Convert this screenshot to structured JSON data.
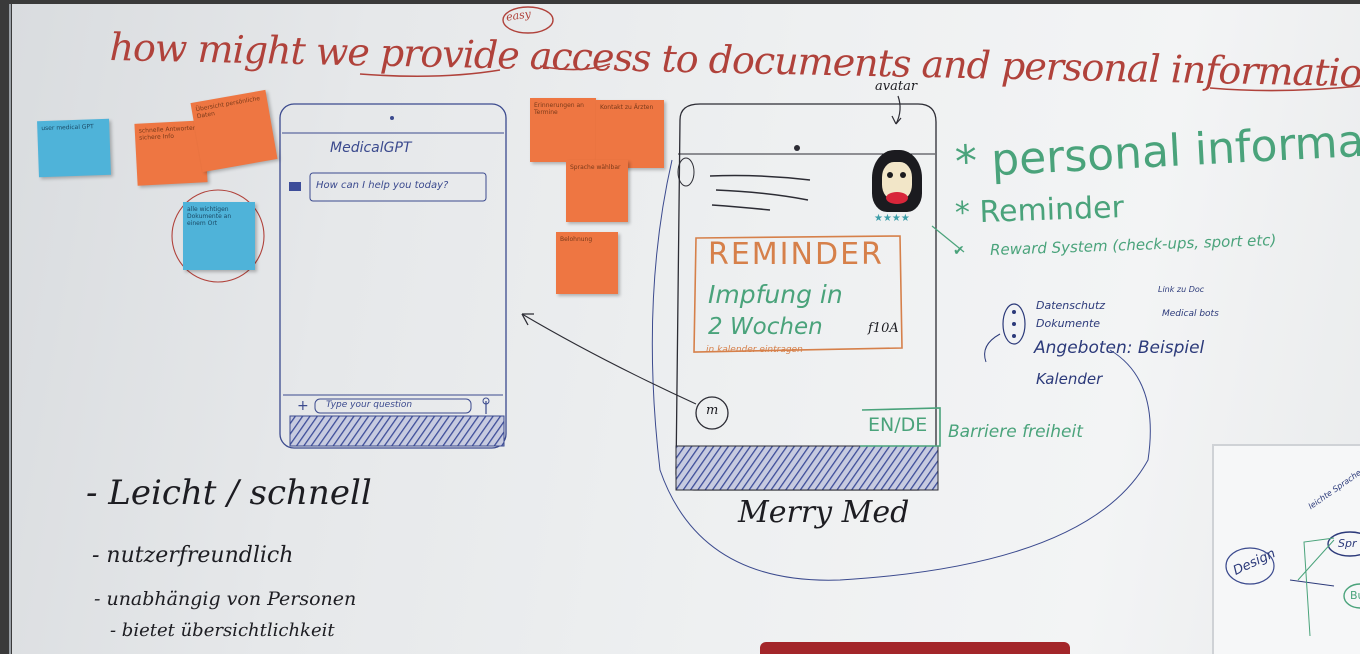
{
  "title": "how might we provide access to documents and personal information TO Students",
  "title_insert": "easy",
  "phone1": {
    "app_name": "MedicalGPT",
    "prompt": "How can I help you today?",
    "input_placeholder": "Type your question"
  },
  "phone2": {
    "avatar_label": "avatar",
    "reminder_heading": "REMINDER",
    "reminder_line1": "Impfung in",
    "reminder_line2": "2 Wochen",
    "reminder_extra": "f10A",
    "calendar_note": "in kalender eintragen",
    "lang_toggle": "EN/DE",
    "name_below": "Merry Med",
    "circle_label": "m"
  },
  "right_list": {
    "item1": "* personal informat",
    "item2": "* Reminder",
    "item3": "Reward System (check-ups, sport etc)",
    "sub1": "Datenschutz",
    "sub2": "Dokumente",
    "sub2_arrow1": "Link zu Doc",
    "sub2_arrow2": "Medical bots",
    "sub3": "Angeboten: Beispiel",
    "sub4": "Kalender",
    "accessibility": "Barriere freiheit"
  },
  "bottom_list": {
    "line1": "- Leicht / schnell",
    "line2": "- nutzerfreundlich",
    "line3": "- unabhängig von Personen",
    "line4": "- bietet übersichtlichkeit"
  },
  "sticky_notes": {
    "blue1": "user medical GPT",
    "orange1": "schnelle Antworten sichere Info",
    "orange2": "Übersicht persönliche Daten",
    "blue2": "alle wichtigen Dokumente an einem Ort",
    "orange3": "Erinnerungen an Termine",
    "orange4": "Kontakt zu Ärzten",
    "orange5": "Sprache wählbar",
    "orange6": "Belohnung"
  },
  "inset": {
    "word1": "Design",
    "word2": "leichte Sprache",
    "word3": "Spr",
    "word4": "Bu"
  },
  "colors": {
    "red_marker": "#b0423b",
    "green_marker": "#4aa37b",
    "navy_marker": "#2c3a7a",
    "orange_marker": "#d6804a",
    "sticky_orange": "#ee7642",
    "sticky_blue": "#4fb3d9"
  }
}
